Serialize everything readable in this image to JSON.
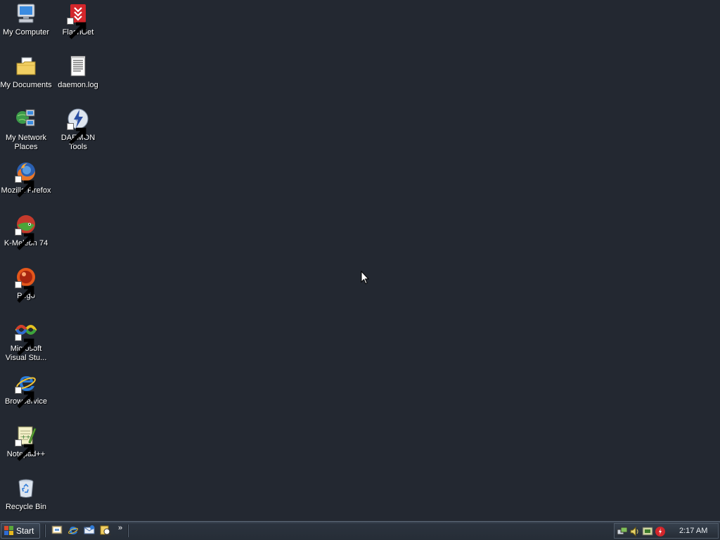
{
  "desktop": {
    "icons": [
      {
        "label": "My Computer",
        "icon": "computer-icon"
      },
      {
        "label": "FlashGet",
        "icon": "flashget-icon",
        "shortcut": true
      },
      {
        "label": "My Documents",
        "icon": "folder-documents-icon"
      },
      {
        "label": "daemon.log",
        "icon": "text-file-icon"
      },
      {
        "label": "My Network Places",
        "icon": "network-places-icon"
      },
      {
        "label": "DAEMON Tools",
        "icon": "daemon-tools-icon",
        "shortcut": true
      },
      {
        "label": "Mozilla Firefox",
        "icon": "firefox-icon",
        "shortcut": true
      },
      {
        "label": "K-Meleon 74",
        "icon": "k-meleon-icon",
        "shortcut": true
      },
      {
        "label": "Pego",
        "icon": "pego-icon",
        "shortcut": true
      },
      {
        "label": "Microsoft Visual Stu...",
        "icon": "visual-studio-icon",
        "shortcut": true
      },
      {
        "label": "Browservice",
        "icon": "internet-explorer-icon",
        "shortcut": true
      },
      {
        "label": "Notepad++",
        "icon": "notepad-plus-plus-icon",
        "shortcut": true
      },
      {
        "label": "Recycle Bin",
        "icon": "recycle-bin-icon"
      }
    ]
  },
  "taskbar": {
    "start_label": "Start",
    "quick_launch": [
      "show-desktop-icon",
      "internet-explorer-icon",
      "outlook-express-icon",
      "windows-media-icon"
    ],
    "chevron": "»",
    "tray_icons": [
      "network-tray-icon",
      "volume-tray-icon",
      "display-tray-icon",
      "antivirus-tray-icon"
    ],
    "clock": "2:17 AM"
  },
  "colors": {
    "desktop_background": "#232831",
    "taskbar": "#2b333e"
  }
}
